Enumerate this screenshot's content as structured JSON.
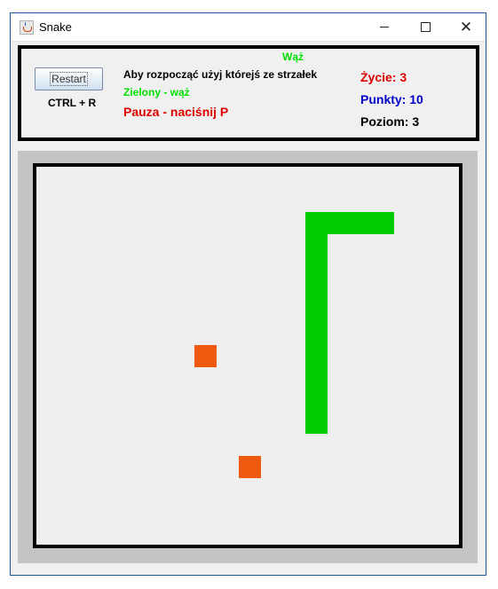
{
  "window": {
    "title": "Snake",
    "minimize_glyph": "",
    "maximize_glyph": "",
    "close_glyph": "✕"
  },
  "controls": {
    "restart_label": "Restart",
    "restart_shortcut": "CTRL + R"
  },
  "info": {
    "game_title": "Wąż",
    "instructions": "Aby rozpocząć użyj którejś ze strzałek",
    "legend": "Zielony - wąż",
    "pause_hint": "Pauza -  naciśnij P"
  },
  "stats": {
    "lives_text": "Życie: 3",
    "points_text": "Punkty: 10",
    "level_text": "Poziom: 3",
    "lives": 3,
    "points": 10,
    "level": 3
  },
  "colors": {
    "snake": "#00cc00",
    "food": "#f05a10",
    "board_bg": "#efefef",
    "frame": "#c4c4c4"
  },
  "game": {
    "grid_cols": 19,
    "grid_rows": 17,
    "snake_cells": [
      [
        12,
        2
      ],
      [
        13,
        2
      ],
      [
        14,
        2
      ],
      [
        15,
        2
      ],
      [
        12,
        3
      ],
      [
        12,
        4
      ],
      [
        12,
        5
      ],
      [
        12,
        6
      ],
      [
        12,
        7
      ],
      [
        12,
        8
      ],
      [
        12,
        9
      ],
      [
        12,
        10
      ],
      [
        12,
        11
      ]
    ],
    "food_cells": [
      [
        7,
        8
      ],
      [
        9,
        13
      ]
    ]
  }
}
